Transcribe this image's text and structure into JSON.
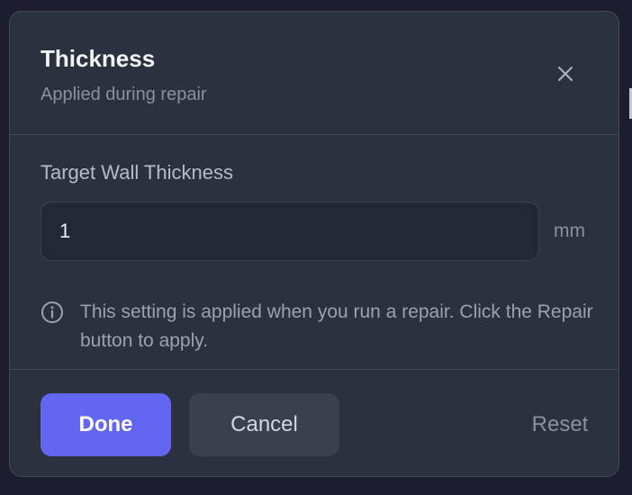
{
  "dialog": {
    "title": "Thickness",
    "subtitle": "Applied during repair",
    "close_icon": "close-icon"
  },
  "field": {
    "label": "Target Wall Thickness",
    "value": "1",
    "unit": "mm"
  },
  "info": {
    "icon": "info-icon",
    "text": "This setting is applied when you run a repair. Click the Repair button to apply."
  },
  "footer": {
    "done_label": "Done",
    "cancel_label": "Cancel",
    "reset_label": "Reset"
  },
  "colors": {
    "backdrop": "#1c1d2e",
    "dialog_bg": "#2c3140",
    "primary": "#6366f1",
    "secondary_btn": "#3b404e",
    "input_bg": "#222836"
  }
}
